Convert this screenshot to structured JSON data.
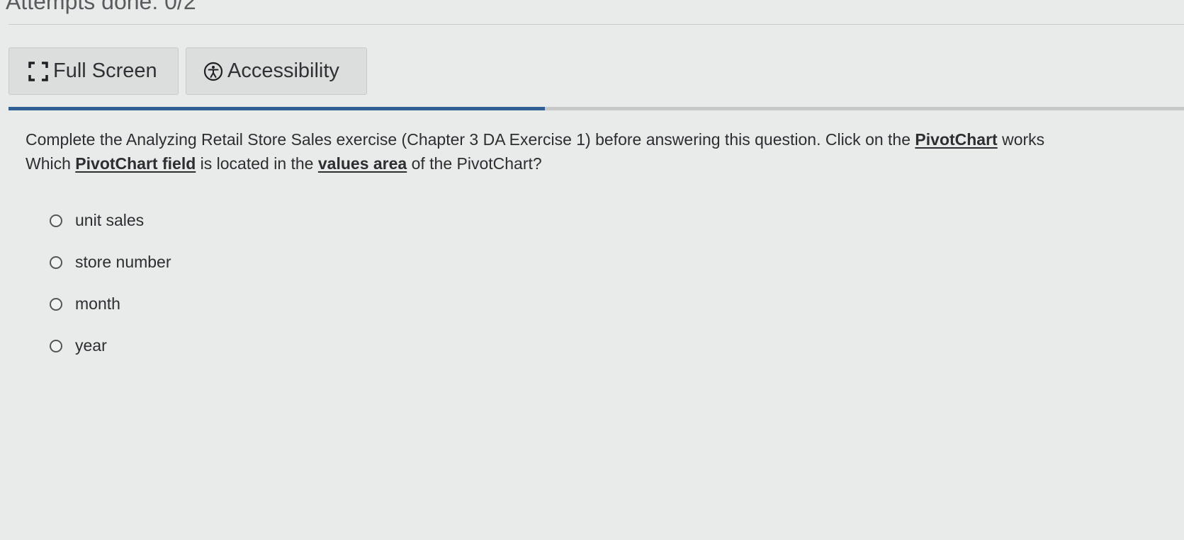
{
  "header": {
    "attempts_text": "Attempts done: 0/2"
  },
  "toolbar": {
    "fullscreen_icon": "fullscreen-icon",
    "fullscreen_label": "Full Screen",
    "accessibility_icon": "accessibility-icon",
    "accessibility_label": "Accessibility"
  },
  "progress": {
    "fraction": 0.456,
    "accent": "#2f5f93"
  },
  "question": {
    "line1_a": "Complete the Analyzing Retail Store Sales exercise (Chapter 3 DA Exercise 1) before answering this question.  Click on the ",
    "line1_b": "PivotChart",
    "line1_c": " works",
    "line2_a": "Which ",
    "line2_b": "PivotChart field",
    "line2_c": " is located in the ",
    "line2_d": "values area",
    "line2_e": " of the PivotChart?"
  },
  "options": [
    {
      "label": "unit sales"
    },
    {
      "label": "store number"
    },
    {
      "label": "month"
    },
    {
      "label": "year"
    }
  ]
}
